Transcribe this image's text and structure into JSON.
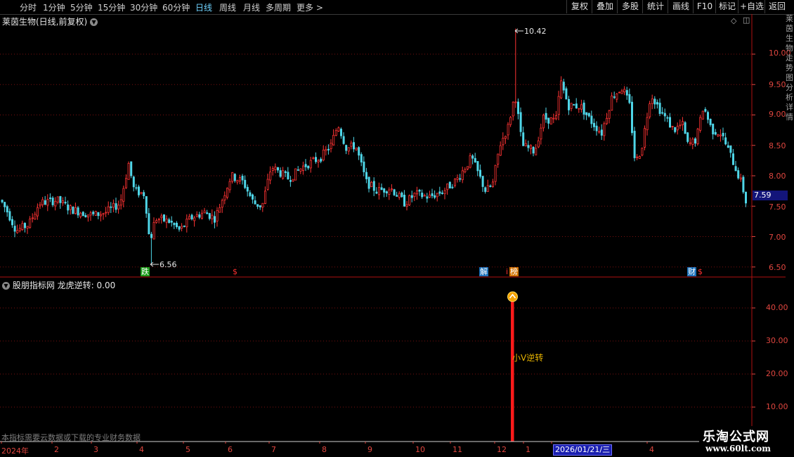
{
  "toolbar": {
    "timeframes": [
      "分时",
      "1分钟",
      "5分钟",
      "15分钟",
      "30分钟",
      "60分钟",
      "日线",
      "周线",
      "月线",
      "多周期",
      "更多 >"
    ],
    "active_index": 6,
    "right_buttons": [
      "复权",
      "叠加",
      "多股",
      "统计",
      "画线",
      "F10",
      "标记",
      "+自选",
      "返回"
    ]
  },
  "main_chart": {
    "title": "莱茵生物(日线,前复权)",
    "price_labels": [
      "10.00",
      "9.50",
      "9.00",
      "8.50",
      "8.00",
      "7.50",
      "7.00",
      "6.50"
    ],
    "current_price": "7.59",
    "high_label": "10.42",
    "low_label": "6.56",
    "event_markers": [
      {
        "text": "跌",
        "color": "#1a9c1a",
        "fg": "#ffffff"
      },
      {
        "text": "$",
        "color": "#000000",
        "fg": "#ff3030"
      },
      {
        "text": "解",
        "color": "#1a6fb8",
        "fg": "#ffffff"
      },
      {
        "text": "i",
        "color": "#000000",
        "fg": "#ff3030"
      },
      {
        "text": "榜",
        "color": "#d07000",
        "fg": "#ffffff"
      },
      {
        "text": "财",
        "color": "#1a6fb8",
        "fg": "#ffffff"
      },
      {
        "text": "$",
        "color": "#000000",
        "fg": "#ff3030"
      }
    ],
    "right_strip_text": "莱茵生物走势图分析详情"
  },
  "indicator": {
    "title": "股朋指标网 龙虎逆转: 0.00",
    "labels": [
      "40.00",
      "30.00",
      "20.00",
      "10.00"
    ],
    "signal_label": "小V逆转",
    "note": "本指标需要云数据或下载的专业财务数据"
  },
  "date_axis": {
    "labels": [
      "2024年",
      "2",
      "3",
      "4",
      "5",
      "6",
      "7",
      "8",
      "9",
      "10",
      "11",
      "12",
      "1",
      "3",
      "4"
    ],
    "selected_date": "2026/01/21/三"
  },
  "watermark": {
    "line1": "乐淘公式网",
    "line2": "www.60lt.com"
  },
  "colors": {
    "up": "#ff3333",
    "down": "#4fd6e8",
    "grid": "#7a0f0f",
    "axis": "#e0463f",
    "signal": "#ff1a1a"
  }
}
